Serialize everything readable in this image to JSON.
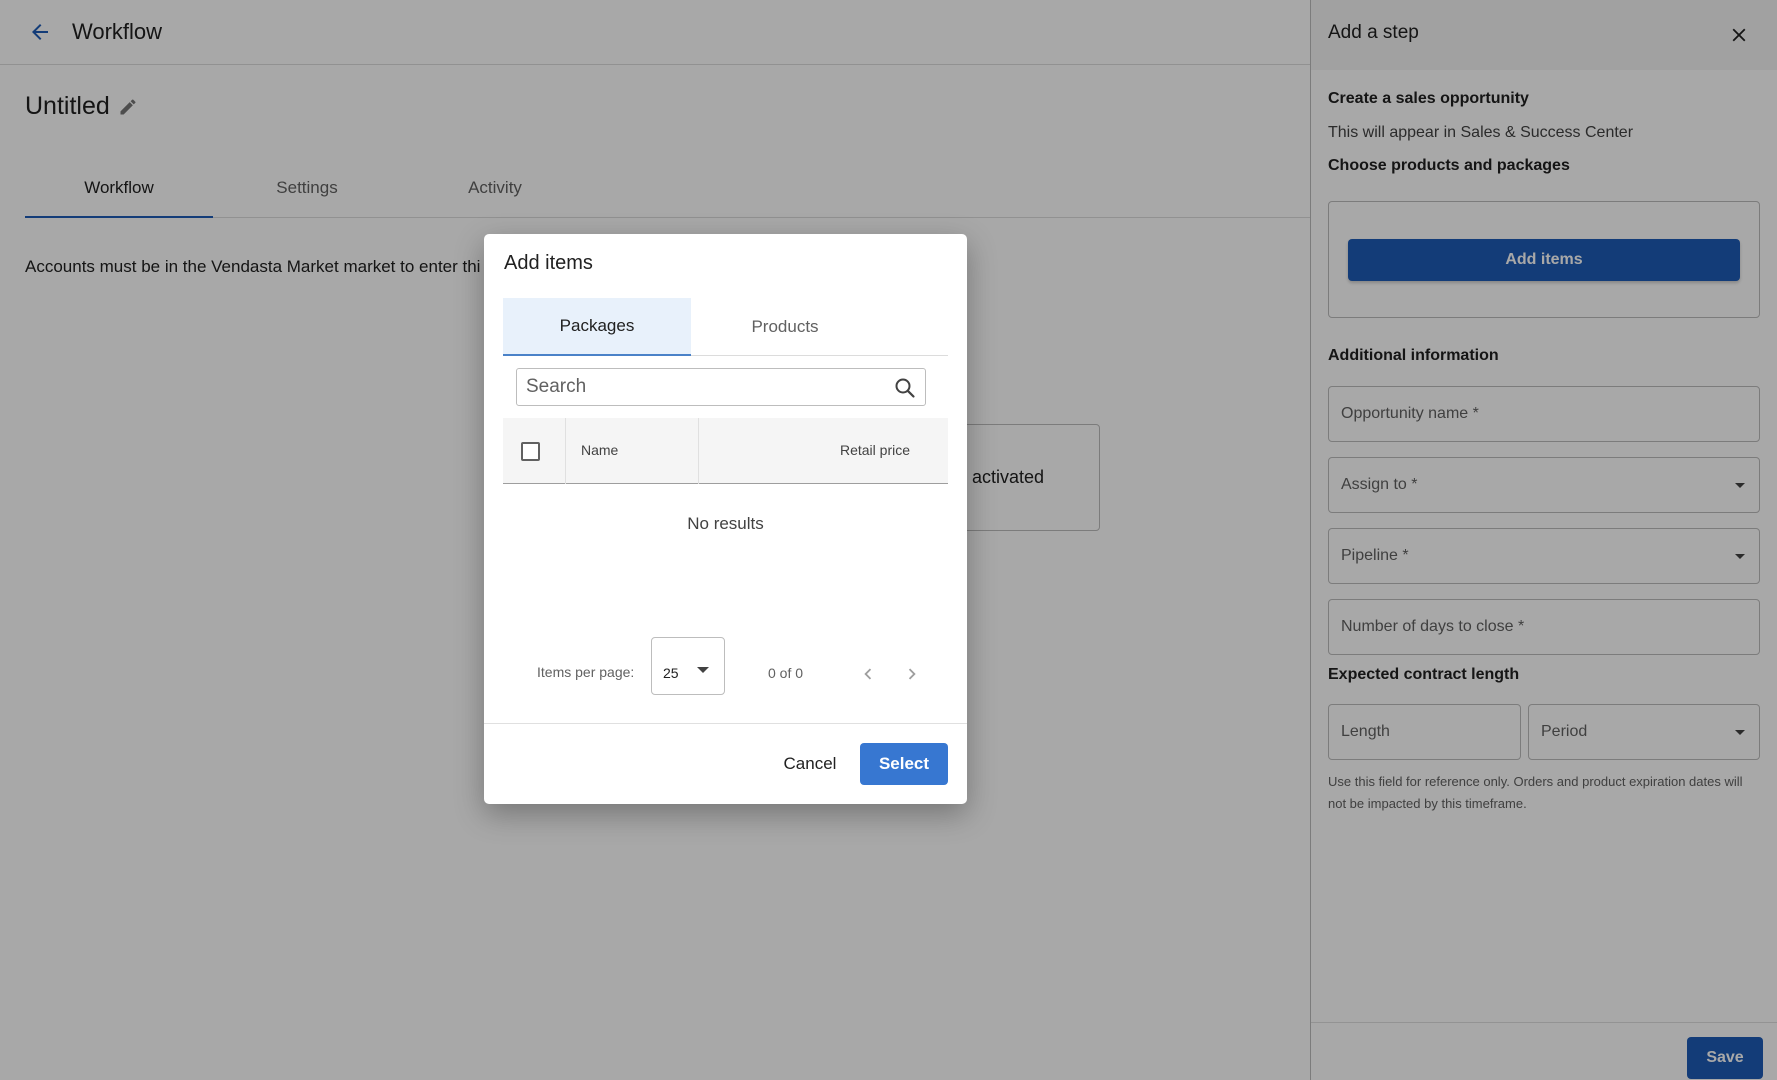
{
  "header": {
    "back_icon": "arrow-left-icon",
    "title": "Workflow"
  },
  "workflow": {
    "name": "Untitled",
    "edit_icon": "pencil-icon"
  },
  "tabs": [
    {
      "label": "Workflow",
      "active": true
    },
    {
      "label": "Settings",
      "active": false
    },
    {
      "label": "Activity",
      "active": false
    }
  ],
  "notice": "Accounts must be in the Vendasta Market market to enter thi",
  "trigger_card": {
    "text": "activated"
  },
  "dialog": {
    "title": "Add items",
    "tabs": [
      {
        "label": "Packages",
        "active": true
      },
      {
        "label": "Products",
        "active": false
      }
    ],
    "search_placeholder": "Search",
    "search_icon": "magnifier-icon",
    "columns": {
      "name": "Name",
      "retail_price": "Retail price"
    },
    "empty_text": "No results",
    "pagination": {
      "items_per_page_label": "Items per page:",
      "items_per_page": "25",
      "range": "0 of 0"
    },
    "cancel_label": "Cancel",
    "select_label": "Select",
    "colors": {
      "primary": "#3777d1",
      "tab_active_bg": "#e8f1fb"
    }
  },
  "panel": {
    "title": "Add a step",
    "close_icon": "close-icon",
    "step_title": "Create a sales opportunity",
    "step_description": "This will appear in Sales & Success Center",
    "products_heading": "Choose products and packages",
    "add_items_label": "Add items",
    "additional_heading": "Additional information",
    "fields": {
      "opportunity_name": "Opportunity name *",
      "assign_to": "Assign to *",
      "pipeline": "Pipeline *",
      "days_to_close": "Number of days to close *"
    },
    "contract_heading": "Expected contract length",
    "length_placeholder": "Length",
    "period_label": "Period",
    "hint": "Use this field for reference only. Orders and product expiration dates will not be impacted by this timeframe.",
    "save_label": "Save",
    "colors": {
      "primary": "#1e5bb6"
    }
  }
}
